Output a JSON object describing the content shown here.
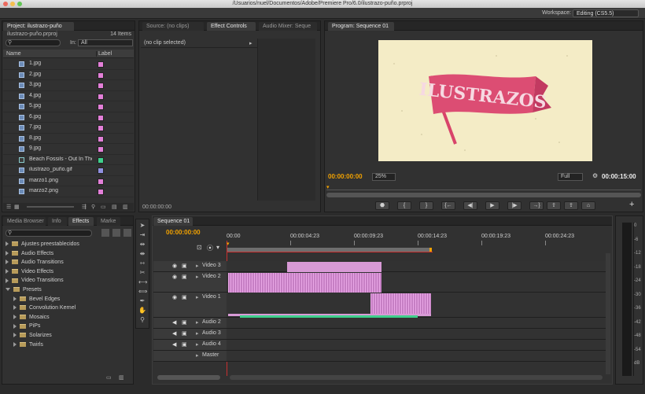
{
  "window": {
    "title": "/Usuarios/nuel/Documentos/Adobe/Premiere Pro/6.0/ilustrazo-puño.prproj"
  },
  "workspace": {
    "label": "Workspace:",
    "value": "Editing (CS5.5)"
  },
  "project": {
    "tab": "Project: ilustrazo-puño",
    "file": "ilustrazo-puño.prproj",
    "count": "14 Items",
    "in_label": "In:",
    "in_value": "All",
    "col_name": "Name",
    "col_label": "Label",
    "items": [
      {
        "name": "1.jpg",
        "color": "#e37fd8"
      },
      {
        "name": "2.jpg",
        "color": "#e37fd8"
      },
      {
        "name": "3.jpg",
        "color": "#e37fd8"
      },
      {
        "name": "4.jpg",
        "color": "#e37fd8"
      },
      {
        "name": "5.jpg",
        "color": "#e37fd8"
      },
      {
        "name": "6.jpg",
        "color": "#e37fd8"
      },
      {
        "name": "7.jpg",
        "color": "#e37fd8"
      },
      {
        "name": "8.jpg",
        "color": "#e37fd8"
      },
      {
        "name": "9.jpg",
        "color": "#e37fd8"
      },
      {
        "name": "Beach Fossils - Out In The",
        "color": "#3fd08c"
      },
      {
        "name": "ilustrazo_puño.gif",
        "color": "#9090e0"
      },
      {
        "name": "marzo1.png",
        "color": "#e37fd8"
      },
      {
        "name": "marzo2.png",
        "color": "#e37fd8"
      }
    ]
  },
  "source": {
    "tabs": [
      "Source: (no clips)",
      "Effect Controls",
      "Audio Mixer: Seque"
    ],
    "no_clip": "(no clip selected)",
    "timecode": "00:00:00:00"
  },
  "program": {
    "tab": "Program: Sequence 01",
    "timecode_left": "00:00:00:00",
    "zoom": "25%",
    "quality": "Full",
    "timecode_right": "00:00:15:00",
    "art_text": "ILUSTRAZOS"
  },
  "effects": {
    "tabs": [
      "Media Browser",
      "Info",
      "Effects",
      "Marke"
    ],
    "tree": [
      {
        "label": "Ajustes preestablecidos",
        "level": 0
      },
      {
        "label": "Audio Effects",
        "level": 0
      },
      {
        "label": "Audio Transitions",
        "level": 0
      },
      {
        "label": "Video Effects",
        "level": 0
      },
      {
        "label": "Video Transitions",
        "level": 0
      },
      {
        "label": "Presets",
        "level": 0,
        "open": true
      },
      {
        "label": "Bevel Edges",
        "level": 1
      },
      {
        "label": "Convolution Kernel",
        "level": 1
      },
      {
        "label": "Mosaics",
        "level": 1
      },
      {
        "label": "PiPs",
        "level": 1
      },
      {
        "label": "Solarizes",
        "level": 1
      },
      {
        "label": "Twirls",
        "level": 1
      }
    ]
  },
  "timeline": {
    "tab": "Sequence 01",
    "timecode": "00:00:00:00",
    "ruler": [
      "00:00",
      "00:00:04:23",
      "00:00:09:23",
      "00:00:14:23",
      "00:00:19:23",
      "00:00:24:23"
    ],
    "tracks": [
      "Video 3",
      "Video 2",
      "Video 1",
      "Audio 2",
      "Audio 3",
      "Audio 4",
      "Master"
    ]
  },
  "meter": {
    "labels": [
      "0",
      "-6",
      "-12",
      "-18",
      "-24",
      "-30",
      "-36",
      "-42",
      "-48",
      "-54",
      "dB"
    ]
  }
}
